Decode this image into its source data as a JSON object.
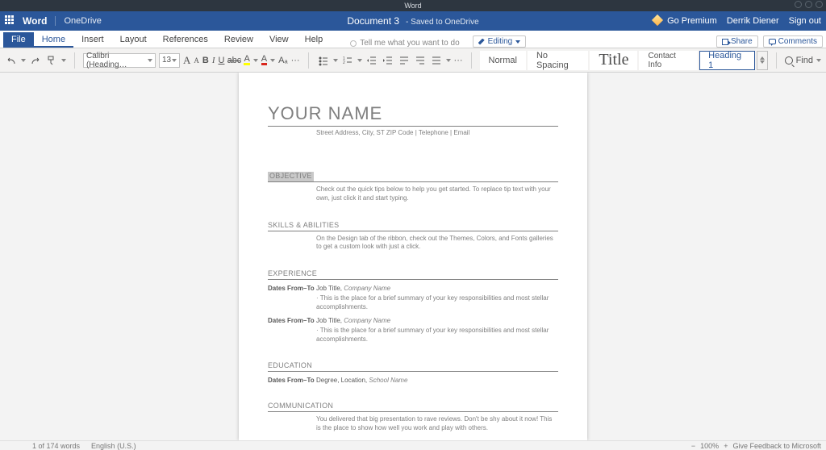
{
  "os": {
    "title": "Word"
  },
  "title": {
    "brand": "Word",
    "onedrive": "OneDrive",
    "doc_name": "Document 3",
    "saved": "- Saved to OneDrive",
    "go_premium": "Go Premium",
    "user": "Derrik Diener",
    "sign_out": "Sign out"
  },
  "tabs": {
    "file": "File",
    "home": "Home",
    "insert": "Insert",
    "layout": "Layout",
    "references": "References",
    "review": "Review",
    "view": "View",
    "help": "Help",
    "tell_me": "Tell me what you want to do",
    "editing": "Editing",
    "share": "Share",
    "comments": "Comments"
  },
  "toolbar": {
    "font_name": "Calibri (Heading…",
    "font_size": "13",
    "grow": "A",
    "shrink": "A",
    "bold": "B",
    "italic": "I",
    "underline": "U",
    "strike": "abc",
    "font_color": "A",
    "highlight": "A",
    "clear": "Aₐ",
    "more": "···",
    "styles": {
      "normal": "Normal",
      "nospacing": "No Spacing",
      "title": "Title",
      "contact": "Contact Info",
      "h1": "Heading 1"
    },
    "find": "Find"
  },
  "document": {
    "name_heading": "YOUR NAME",
    "contact_line": "Street Address, City, ST ZIP Code | Telephone | Email",
    "objective_head": "OBJECTIVE",
    "objective_body": "Check out the quick tips below to help you get started. To replace tip text with your own, just click it and start typing.",
    "skills_head": "SKILLS & ABILITIES",
    "skills_body": "On the Design tab of the ribbon, check out the Themes, Colors, and Fonts galleries to get a custom look with just a click.",
    "experience_head": "EXPERIENCE",
    "exp_dates": "Dates From–To",
    "exp_job": "Job Title,",
    "exp_company": "Company Name",
    "exp_desc": "· This is the place for a brief summary of your key responsibilities and most stellar accomplishments.",
    "education_head": "EDUCATION",
    "edu_line": "Degree,  Location,",
    "edu_school": "School Name",
    "comm_head": "COMMUNICATION",
    "comm_body": "You delivered that big presentation to rave reviews. Don't be shy about it now! This is the place to show how well you work and play with others."
  },
  "status": {
    "words": "1 of 174 words",
    "lang": "English (U.S.)",
    "zoom_minus": "−",
    "zoom": "100%",
    "zoom_plus": "+",
    "feedback": "Give Feedback to Microsoft"
  }
}
